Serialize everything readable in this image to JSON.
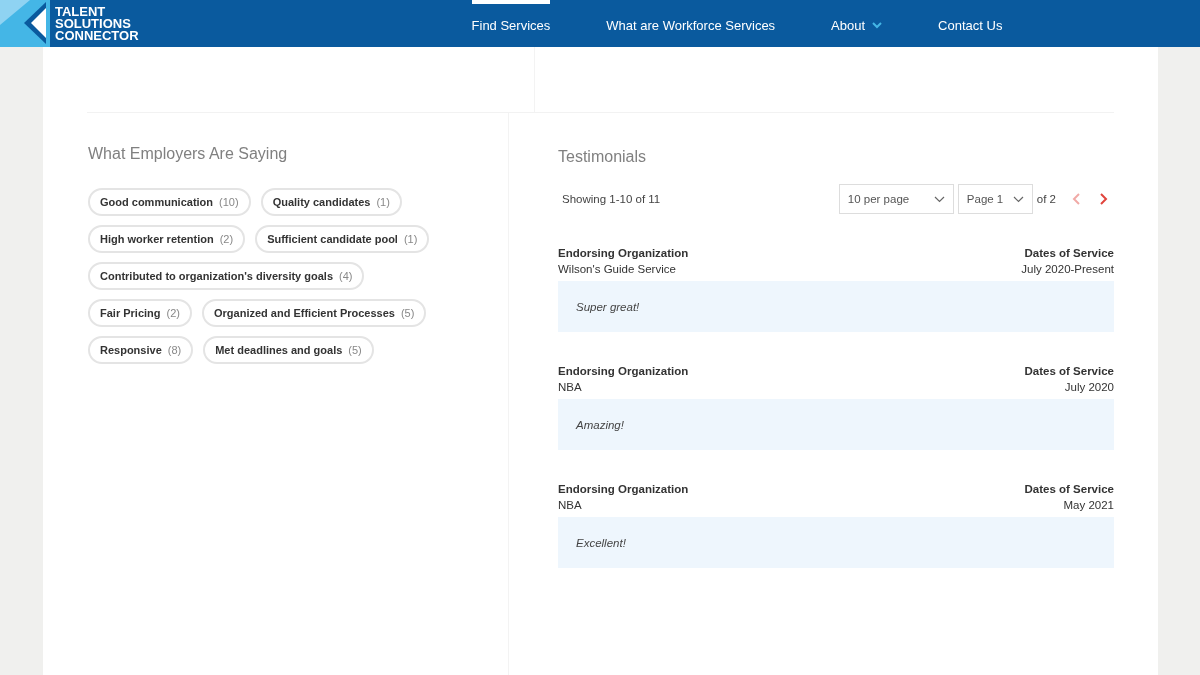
{
  "header": {
    "logo_lines": [
      "TALENT",
      "SOLUTIONS",
      "CONNECTOR"
    ],
    "nav": [
      {
        "label": "Find Services",
        "selected": true,
        "dropdown": false
      },
      {
        "label": "What are Workforce Services",
        "selected": false,
        "dropdown": false
      },
      {
        "label": "About",
        "selected": false,
        "dropdown": true
      },
      {
        "label": "Contact Us",
        "selected": false,
        "dropdown": false
      }
    ]
  },
  "feedback": {
    "title": "What Employers Are Saying",
    "tags": [
      {
        "label": "Good communication",
        "count": "(10)"
      },
      {
        "label": "Quality candidates",
        "count": "(1)"
      },
      {
        "label": "High worker retention",
        "count": "(2)"
      },
      {
        "label": "Sufficient candidate pool",
        "count": "(1)"
      },
      {
        "label": "Contributed to organization's diversity goals",
        "count": "(4)"
      },
      {
        "label": "Fair Pricing",
        "count": "(2)"
      },
      {
        "label": "Organized and Efficient Processes",
        "count": "(5)"
      },
      {
        "label": "Responsive",
        "count": "(8)"
      },
      {
        "label": "Met deadlines and goals",
        "count": "(5)"
      }
    ]
  },
  "testimonials": {
    "title": "Testimonials",
    "showing": "Showing 1-10 of 11",
    "per_page": "10 per page",
    "page": "Page 1",
    "of_pages": "of 2",
    "prev_disabled": true,
    "next_disabled": false,
    "items": [
      {
        "org_label": "Endorsing Organization",
        "org": "Wilson's Guide Service",
        "dates_label": "Dates of Service",
        "dates": "July 2020-Present",
        "quote": "Super great!"
      },
      {
        "org_label": "Endorsing Organization",
        "org": "NBA",
        "dates_label": "Dates of Service",
        "dates": "July 2020",
        "quote": "Amazing!"
      },
      {
        "org_label": "Endorsing Organization",
        "org": "NBA",
        "dates_label": "Dates of Service",
        "dates": "May 2021",
        "quote": "Excellent!"
      }
    ]
  }
}
